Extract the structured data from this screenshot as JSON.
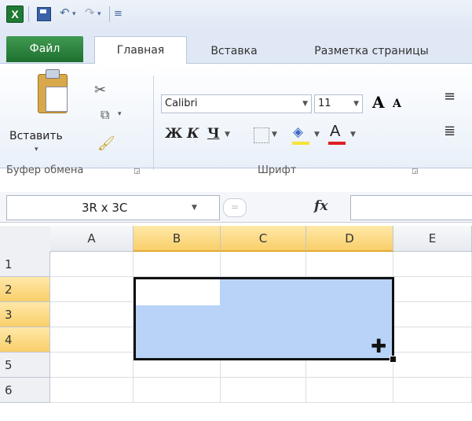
{
  "quick_access": {
    "app_icon": "X",
    "undo_glyph": "↶",
    "redo_glyph": "↷",
    "dropdown_glyph": "▾",
    "customize_glyph": "≡"
  },
  "tabs": {
    "file": "Файл",
    "home": "Главная",
    "insert": "Вставка",
    "page_layout": "Разметка страницы"
  },
  "clipboard": {
    "paste_label": "Вставить",
    "group_label": "Буфер обмена"
  },
  "font": {
    "name": "Calibri",
    "size": "11",
    "group_label": "Шрифт",
    "grow_label": "A",
    "shrink_label": "A",
    "bold": "Ж",
    "italic": "К",
    "underline": "Ч",
    "font_color_label": "А"
  },
  "formula_bar": {
    "name_box": "3R x 3C",
    "fx": "fx",
    "value": ""
  },
  "grid": {
    "columns": [
      "A",
      "B",
      "C",
      "D",
      "E"
    ],
    "rows": [
      "1",
      "2",
      "3",
      "4",
      "5",
      "6"
    ],
    "selected_columns": [
      "B",
      "C",
      "D"
    ],
    "selected_rows": [
      "2",
      "3",
      "4"
    ]
  },
  "colors": {
    "selection_fill": "#b8d3f7",
    "header_highlight": "#f9cf6a",
    "file_tab": "#2e8a40"
  }
}
